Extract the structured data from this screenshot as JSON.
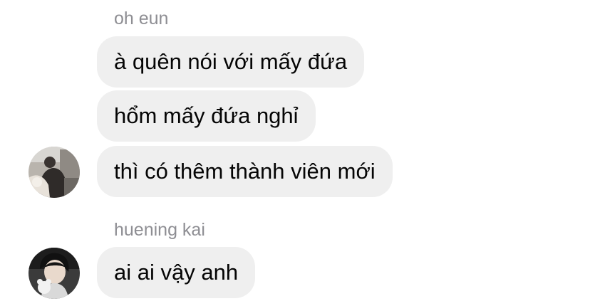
{
  "chat": {
    "groups": [
      {
        "sender": "oh eun",
        "avatar_icon": "user-photo-icon",
        "messages": [
          "à quên nói với mấy đứa",
          "hổm mấy đứa nghỉ",
          "thì có thêm thành viên mới"
        ]
      },
      {
        "sender": "huening kai",
        "avatar_icon": "user-photo-icon",
        "messages": [
          "ai ai vậy anh"
        ]
      }
    ]
  },
  "colors": {
    "bubble": "#efefef",
    "sender_name": "#8e8e93",
    "message_text": "#050505"
  }
}
